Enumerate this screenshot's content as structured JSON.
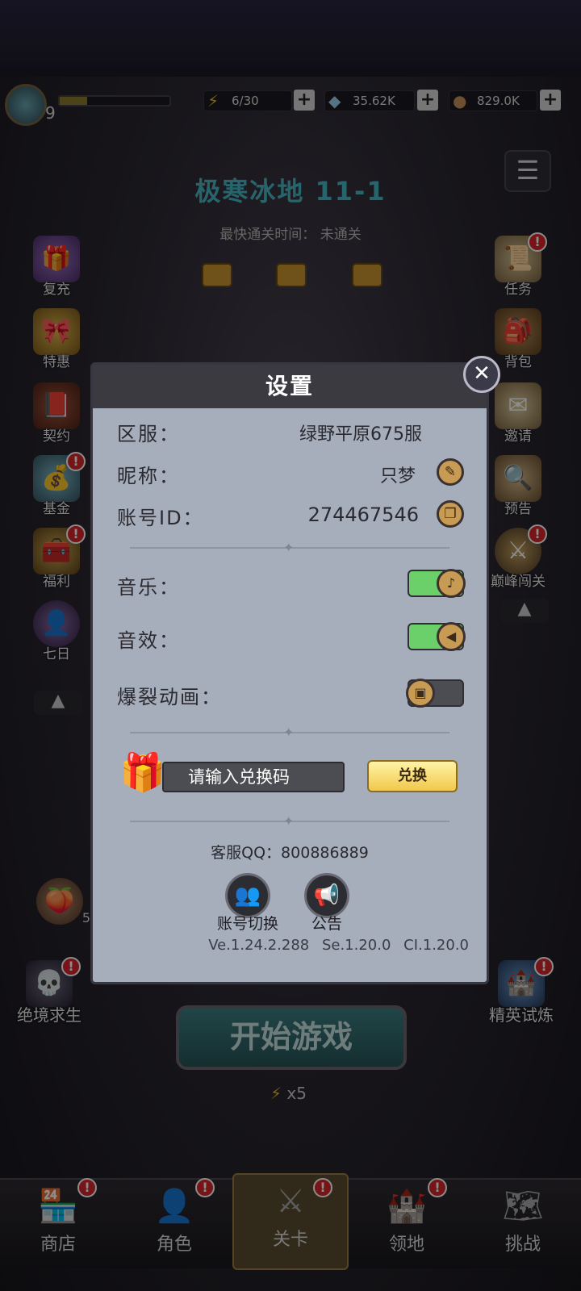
{
  "topbar": {
    "level": "9",
    "xp_fraction": 0.25,
    "energy": "6/30",
    "gems": "35.62K",
    "coins": "829.0K"
  },
  "stage": {
    "title": "极寒冰地 11-1",
    "fastest_label": "最快通关时间：",
    "fastest_value": "未通关"
  },
  "left_icons": [
    {
      "label": "复充",
      "badge": ""
    },
    {
      "label": "特惠",
      "badge": ""
    },
    {
      "label": "契约",
      "badge": ""
    },
    {
      "label": "基金",
      "badge": "!"
    },
    {
      "label": "福利",
      "badge": "!"
    },
    {
      "label": "七日",
      "badge": ""
    }
  ],
  "right_icons": [
    {
      "label": "任务",
      "badge": "!"
    },
    {
      "label": "背包",
      "badge": ""
    },
    {
      "label": "邀请",
      "badge": ""
    },
    {
      "label": "预告",
      "badge": ""
    },
    {
      "label": "巅峰闯关",
      "badge": "!"
    }
  ],
  "left_bottom": {
    "label": "绝境求生",
    "badge": "!",
    "count": "5"
  },
  "right_bottom": {
    "label": "精英试炼",
    "badge": "!"
  },
  "start": {
    "label": "开始游戏",
    "energy_cost": "x5"
  },
  "nav": [
    {
      "label": "商店"
    },
    {
      "label": "角色"
    },
    {
      "label": "关卡"
    },
    {
      "label": "领地"
    },
    {
      "label": "挑战"
    }
  ],
  "dialog": {
    "title": "设置",
    "server_label": "区服：",
    "server_value": "绿野平原675服",
    "nickname_label": "昵称：",
    "nickname_value": "只梦",
    "account_label": "账号ID：",
    "account_value": "274467546",
    "music_label": "音乐：",
    "music_on": true,
    "sfx_label": "音效：",
    "sfx_on": true,
    "burst_label": "爆裂动画：",
    "burst_on": false,
    "code_placeholder": "请输入兑换码",
    "redeem_label": "兑换",
    "service_qq": "客服QQ：800886889",
    "switch_account_label": "账号切换",
    "notice_label": "公告",
    "versions": "Ve.1.24.2.288 Se.1.20.0 CI.1.20.0"
  }
}
